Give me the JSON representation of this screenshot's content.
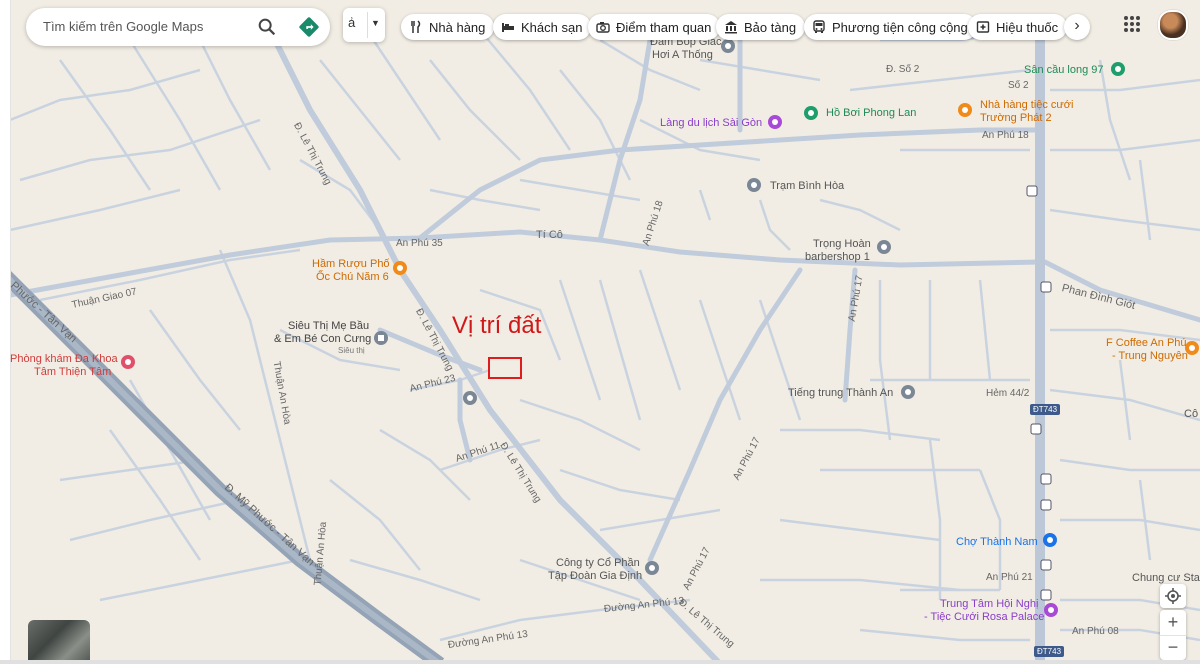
{
  "search": {
    "placeholder": "Tìm kiếm trên Google Maps"
  },
  "chips": [
    {
      "label": "Nhà hàng",
      "icon": "restaurant-icon"
    },
    {
      "label": "Khách sạn",
      "icon": "hotel-icon"
    },
    {
      "label": "Điểm tham quan",
      "icon": "camera-icon"
    },
    {
      "label": "Bảo tàng",
      "icon": "museum-icon"
    },
    {
      "label": "Phương tiện công cộng",
      "icon": "bus-icon"
    },
    {
      "label": "Hiệu thuốc",
      "icon": "pharmacy-icon"
    }
  ],
  "marker": {
    "label": "Vị trí đất"
  },
  "streets": {
    "an_phu_35": "An Phú 35",
    "ti_co": "Tí Cô",
    "le_thi_trung_1": "Đ. Lê Thị Trung",
    "le_thi_trung_2": "Đ. Lê Thị Trung",
    "le_thi_trung_3": "Đ. Lê Thị Trung",
    "le_thi_trung_4": "Đ. Lê Thị Trung",
    "an_phu_18_v": "An Phú 18",
    "an_phu_18_h": "An Phú 18",
    "an_phu_17_a": "An Phú 17",
    "an_phu_17_b": "An Phú 17",
    "an_phu_17_c": "An Phú 17",
    "an_phu_23": "An Phú 23",
    "an_phu_11": "An Phú 11",
    "an_phu_21": "An Phú 21",
    "an_phu_08": "An Phú 08",
    "duong_an_phu_13_a": "Đường An Phú 13",
    "duong_an_phu_13_b": "Đường An Phú 13",
    "thuan_giao_07": "Thuận Giao 07",
    "thuan_an_hoa_1": "Thuận An Hòa",
    "thuan_an_hoa_2": "Thuận An Hòa",
    "my_phuoc_tan_van_1": "Đ. Mỹ Phước - Tân Vạn",
    "my_phuoc_tan_van_2": "Phước - Tân Vạn",
    "phan_dinh_giot": "Phan Đình Giót",
    "so_2_a": "Đ. Số 2",
    "so_2_b": "Số 2",
    "hem_44_2": "Hẻm 44/2",
    "dt743_a": "ĐT743",
    "dt743_b": "ĐT743"
  },
  "places": {
    "san_cau_long": "Sân cầu long 97",
    "ho_boi": "Hồ Bơi Phong Lan",
    "lang_du_lich": "Làng du lịch Sài Gòn",
    "nha_hang_tiec_cuoi_1": "Nhà hàng tiệc cưới",
    "nha_hang_tiec_cuoi_2": "Trường Phát 2",
    "tram_binh_hoa": "Trạm Bình Hòa",
    "trong_hoan_1": "Trọng Hoàn",
    "trong_hoan_2": "barbershop 1",
    "ham_ruou_1": "Hầm Rượu Phố",
    "ham_ruou_2": "Ốc Chú Năm 6",
    "sieu_thi_1": "Siêu Thị Mẹ Bầu",
    "sieu_thi_2": "& Em Bé Con Cưng",
    "sieu_thi_3": "Siêu thị",
    "phong_kham_1": "Phòng khám Đa Khoa",
    "phong_kham_2": "Tâm Thiện Tâm",
    "tieng_trung": "Tiếng trung Thành An",
    "f_coffee_1": "F Coffee An Phú",
    "f_coffee_2": "- Trung Nguyên",
    "cho_thanh_nam": "Chợ Thành Nam",
    "cong_ty_1": "Công ty Cổ Phần",
    "cong_ty_2": "Tập Đoàn Gia Định",
    "trung_tam_1": "Trung Tâm Hội Nghị",
    "trung_tam_2": "- Tiệc Cưới Rosa Palace",
    "chung_cu": "Chung cư Star",
    "dam_bop_1": "Đấm Bóp Giác",
    "dam_bop_2": "Hơi A Thống",
    "co_right": "Cô"
  },
  "colors": {
    "map_bg": "#f1ede4",
    "road": "#ffffff",
    "highway": "#9aa8b8",
    "minor": "#c9d3e0",
    "marker_red": "#e01c1c"
  }
}
